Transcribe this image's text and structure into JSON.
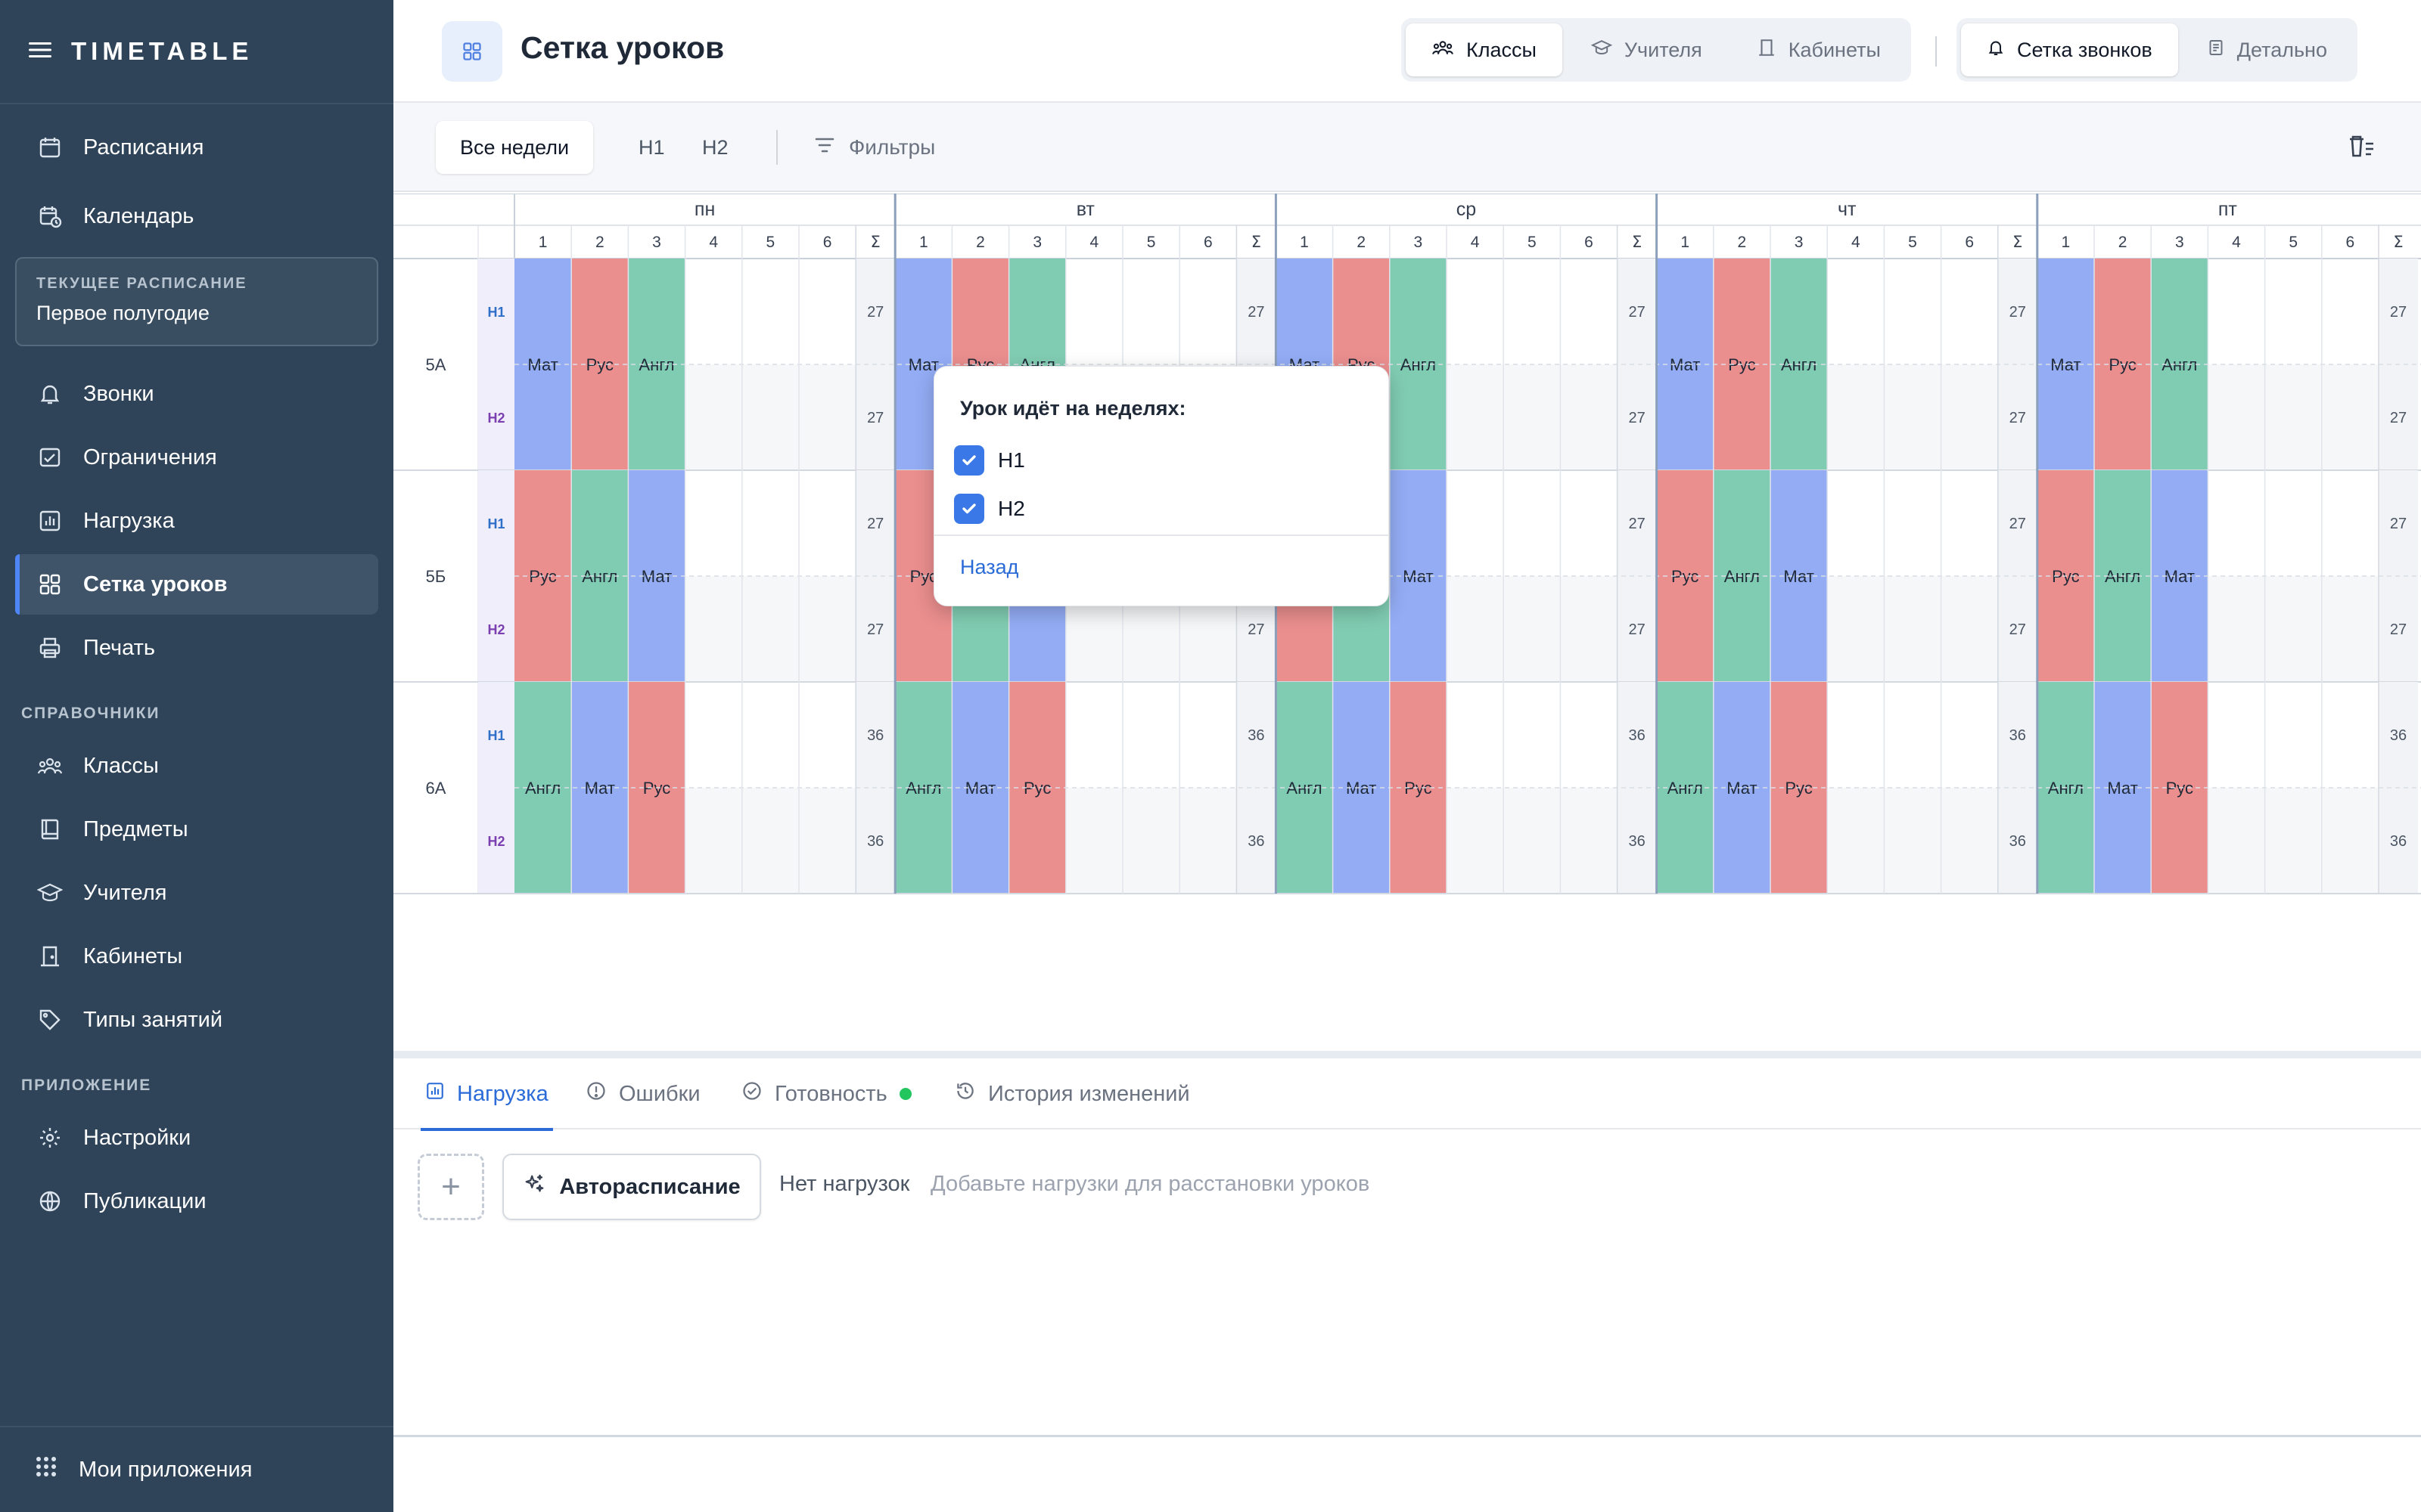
{
  "sidebar": {
    "logo": "TIMETABLE",
    "items_top": [
      {
        "label": "Расписания",
        "icon": "calendar-icon"
      },
      {
        "label": "Календарь",
        "icon": "calendar-clock-icon"
      }
    ],
    "current_schedule": {
      "label": "ТЕКУЩЕЕ РАСПИСАНИЕ",
      "value": "Первое полугодие"
    },
    "items_main": [
      {
        "label": "Звонки",
        "icon": "bell-icon"
      },
      {
        "label": "Ограничения",
        "icon": "constraints-icon"
      },
      {
        "label": "Нагрузка",
        "icon": "chart-icon"
      },
      {
        "label": "Сетка уроков",
        "icon": "grid-icon",
        "active": true
      },
      {
        "label": "Печать",
        "icon": "printer-icon"
      }
    ],
    "section_refs": "СПРАВОЧНИКИ",
    "items_refs": [
      {
        "label": "Классы",
        "icon": "group-icon"
      },
      {
        "label": "Предметы",
        "icon": "book-icon"
      },
      {
        "label": "Учителя",
        "icon": "graduation-cap-icon"
      },
      {
        "label": "Кабинеты",
        "icon": "door-icon"
      },
      {
        "label": "Типы занятий",
        "icon": "tag-icon"
      }
    ],
    "section_app": "ПРИЛОЖЕНИЕ",
    "items_app": [
      {
        "label": "Настройки",
        "icon": "gear-icon"
      },
      {
        "label": "Публикации",
        "icon": "globe-icon"
      }
    ],
    "bottom": {
      "label": "Мои приложения",
      "icon": "apps-grid-icon"
    }
  },
  "header": {
    "title": "Сетка уроков",
    "view_tabs": [
      {
        "label": "Классы",
        "active": true
      },
      {
        "label": "Учителя",
        "active": false
      },
      {
        "label": "Кабинеты",
        "active": false
      }
    ],
    "mode_tabs": [
      {
        "label": "Сетка звонков",
        "active": true
      },
      {
        "label": "Детально",
        "active": false
      }
    ]
  },
  "toolbar": {
    "weeks": [
      {
        "label": "Все недели",
        "active": true
      },
      {
        "label": "Н1",
        "active": false
      },
      {
        "label": "Н2",
        "active": false
      }
    ],
    "filters_label": "Фильтры"
  },
  "grid": {
    "days": [
      "пн",
      "вт",
      "ср",
      "чт",
      "пт"
    ],
    "periods": [
      "1",
      "2",
      "3",
      "4",
      "5",
      "6"
    ],
    "sum_label": "Σ",
    "week_labels": [
      "Н1",
      "Н2"
    ],
    "subject_colors": {
      "Мат": "#93acf4",
      "Рус": "#ea8e8e",
      "Англ": "#80ccb2"
    },
    "classes": [
      {
        "name": "5А",
        "lessons": [
          "Мат",
          "Рус",
          "Англ"
        ],
        "sum_h1": "27",
        "sum_h2": "27"
      },
      {
        "name": "5Б",
        "lessons": [
          "Рус",
          "Англ",
          "Мат"
        ],
        "sum_h1": "27",
        "sum_h2": "27"
      },
      {
        "name": "6А",
        "lessons": [
          "Англ",
          "Мат",
          "Рус"
        ],
        "sum_h1": "36",
        "sum_h2": "36"
      }
    ]
  },
  "popup": {
    "title": "Урок идёт на неделях:",
    "options": [
      {
        "label": "Н1",
        "checked": true
      },
      {
        "label": "Н2",
        "checked": true
      }
    ],
    "back_label": "Назад"
  },
  "bottom_panel": {
    "tabs": [
      {
        "label": "Нагрузка",
        "icon": "chart-icon",
        "active": true
      },
      {
        "label": "Ошибки",
        "icon": "alert-circle-icon",
        "active": false
      },
      {
        "label": "Готовность",
        "icon": "check-circle-icon",
        "active": false,
        "status_dot": "#22c55e"
      },
      {
        "label": "История изменений",
        "icon": "history-icon",
        "active": false
      }
    ],
    "add_label": "+",
    "auto_label": "Автораспис­ание",
    "no_load_label": "Нет нагрузок",
    "no_load_hint": "Добавьте нагрузки для расстановки уроков"
  }
}
